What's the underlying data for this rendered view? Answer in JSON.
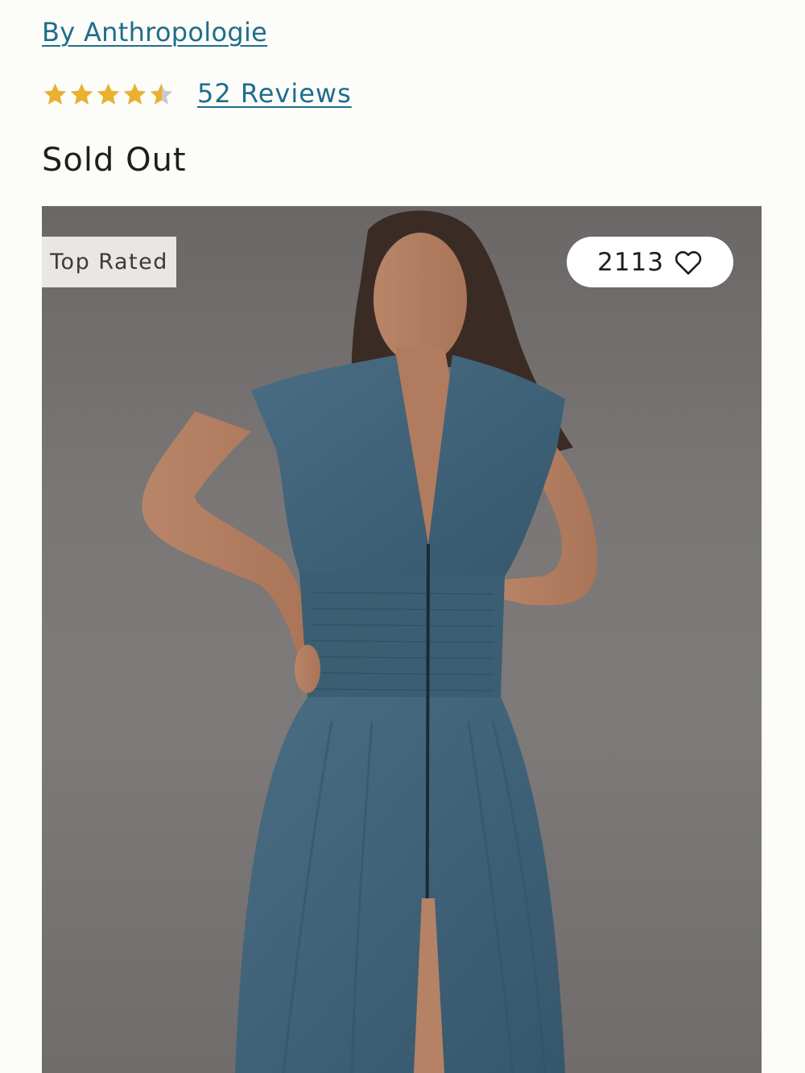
{
  "product": {
    "brand_link": "By Anthropologie",
    "rating": 4.5,
    "rating_max": 5,
    "reviews_link": "52 Reviews",
    "status": "Sold Out"
  },
  "image": {
    "badge": "Top Rated",
    "favorite_count": "2113",
    "favorite_icon": "heart-outline-icon"
  },
  "colors": {
    "link": "#1f6d8c",
    "star_filled": "#e8b12e",
    "star_empty": "#c9c9c9"
  }
}
